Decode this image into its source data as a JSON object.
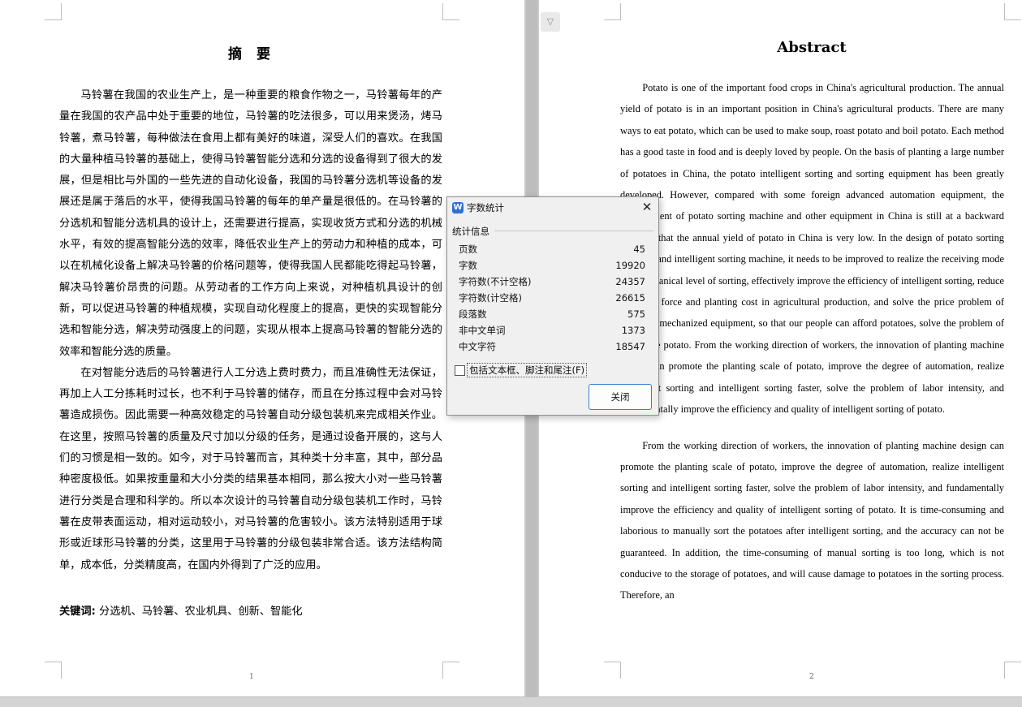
{
  "page1": {
    "title": "摘 要",
    "paragraphs": [
      "马铃薯在我国的农业生产上，是一种重要的粮食作物之一，马铃薯每年的产量在我国的农产品中处于重要的地位，马铃薯的吃法很多，可以用来煲汤，烤马铃薯，煮马铃薯，每种做法在食用上都有美好的味道，深受人们的喜欢。在我国的大量种植马铃薯的基础上，使得马铃薯智能分选和分选的设备得到了很大的发展，但是相比与外国的一些先进的自动化设备，我国的马铃薯分选机等设备的发展还是属于落后的水平，使得我国马铃薯的每年的单产量是很低的。在马铃薯的分选机和智能分选机具的设计上，还需要进行提高，实现收货方式和分选的机械水平，有效的提高智能分选的效率，降低农业生产上的劳动力和种植的成本，可以在机械化设备上解决马铃薯的价格问题等，使得我国人民都能吃得起马铃薯，解决马铃薯价昂贵的问题。从劳动者的工作方向上来说，对种植机具设计的创新，可以促进马铃薯的种植规模，实现自动化程度上的提高，更快的实现智能分选和智能分选，解决劳动强度上的问题，实现从根本上提高马铃薯的智能分选的效率和智能分选的质量。",
      "在对智能分选后的马铃薯进行人工分选上费时费力，而且准确性无法保证，再加上人工分拣耗时过长，也不利于马铃薯的储存，而且在分拣过程中会对马铃薯造成损伤。因此需要一种高效稳定的马铃薯自动分级包装机来完成相关作业。在这里，按照马铃薯的质量及尺寸加以分级的任务，是通过设备开展的，这与人们的习惯是相一致的。如今，对于马铃薯而言，其种类十分丰富，其中，部分品种密度极低。如果按重量和大小分类的结果基本相同，那么按大小对一些马铃薯进行分类是合理和科学的。所以本次设计的马铃薯自动分级包装机工作时，马铃薯在皮带表面运动，相对运动较小，对马铃薯的危害较小。该方法特别适用于球形或近球形马铃薯的分类，这里用于马铃薯的分级包装非常合适。该方法结构简单，成本低，分类精度高，在国内外得到了广泛的应用。"
    ],
    "keywords_label": "关键词:",
    "keywords": " 分选机、马铃薯、农业机具、创新、智能化",
    "page_number": "1"
  },
  "page2": {
    "title": "Abstract",
    "paragraphs": [
      "Potato is one of the important food crops in China's agricultural production. The annual yield of potato is in an important position in China's agricultural products. There are many ways to eat potato, which can be used to make soup, roast potato and boil potato. Each method has a good taste in food and is deeply loved by people. On the basis of planting a large number of potatoes in China, the potato intelligent sorting and sorting equipment has been greatly developed. However, compared with some foreign advanced automation equipment, the development of potato sorting machine and other equipment in China is still at a backward level, so that the annual yield of potato in China is very low. In the design of potato sorting machine and intelligent sorting machine, it needs to be improved to realize the receiving mode and mechanical level of sorting, effectively improve the efficiency of intelligent sorting, reduce the labor force and planting cost in agricultural production, and solve the price problem of potato in mechanized equipment, so that our people can afford potatoes, solve the problem of expensive potato. From the working direction of workers, the innovation of planting machine design can promote the planting scale of potato, improve the degree of automation, realize intelligent sorting and intelligent sorting faster, solve the problem of labor intensity, and fundamentally improve the efficiency and quality of intelligent sorting of potato.",
      "From the working direction of workers, the innovation of planting machine design can promote the planting scale of potato, improve the degree of automation, realize intelligent sorting and intelligent sorting faster, solve the problem of labor intensity, and fundamentally improve the efficiency and quality of intelligent sorting of potato. It is time-consuming and laborious to manually sort the potatoes after intelligent sorting, and the accuracy can not be guaranteed. In addition, the time-consuming of manual sorting is too long, which is not conducive to the storage of potatoes, and will cause damage to potatoes in the sorting process. Therefore, an"
    ],
    "page_number": "2"
  },
  "dialog": {
    "icon_letter": "W",
    "title": "字数统计",
    "close_glyph": "✕",
    "group_label": "统计信息",
    "stats": [
      {
        "label": "页数",
        "value": "45"
      },
      {
        "label": "字数",
        "value": "19920"
      },
      {
        "label": "字符数(不计空格)",
        "value": "24357"
      },
      {
        "label": "字符数(计空格)",
        "value": "26615"
      },
      {
        "label": "段落数",
        "value": "575"
      },
      {
        "label": "非中文单词",
        "value": "1373"
      },
      {
        "label": "中文字符",
        "value": "18547"
      }
    ],
    "checkbox_label": "包括文本框、脚注和尾注(F)",
    "checkbox_checked": false,
    "close_button_label": "关闭"
  },
  "toolbar": {
    "collapse_glyph": "▽"
  }
}
